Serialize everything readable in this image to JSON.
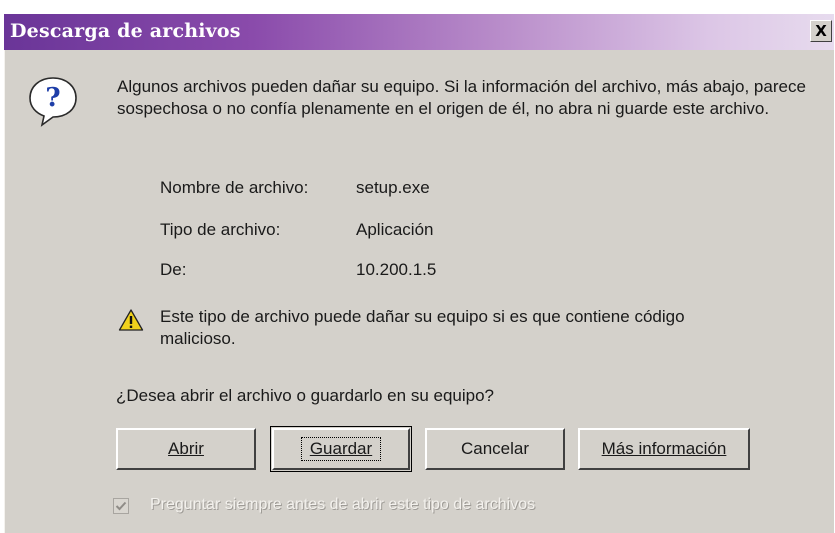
{
  "window": {
    "title": "Descarga de archivos",
    "close_label": "X"
  },
  "icons": {
    "main": "question-icon",
    "warning": "warning-icon"
  },
  "message": "Algunos archivos pueden dañar su equipo. Si la información del archivo, más abajo, parece sospechosa o no confía plenamente en el origen de él, no abra ni guarde este archivo.",
  "file_info": {
    "name_label": "Nombre de archivo:",
    "name_value": "setup.exe",
    "type_label": "Tipo de archivo:",
    "type_value": "Aplicación",
    "from_label": "De:",
    "from_value": "10.200.1.5"
  },
  "warning": "Este tipo de archivo puede dañar su equipo si es que contiene código malicioso.",
  "question": "¿Desea abrir el archivo o guardarlo en su equipo?",
  "buttons": {
    "open": "Abrir",
    "save": "Guardar",
    "cancel": "Cancelar",
    "more_info": "Más información"
  },
  "checkbox": {
    "label": "Preguntar siempre antes de abrir este tipo de archivos",
    "checked": true,
    "disabled": true
  },
  "colors": {
    "titlebar_start": "#6a3598",
    "titlebar_end": "#e7dbee",
    "dialog_bg": "#d4d1cb"
  }
}
